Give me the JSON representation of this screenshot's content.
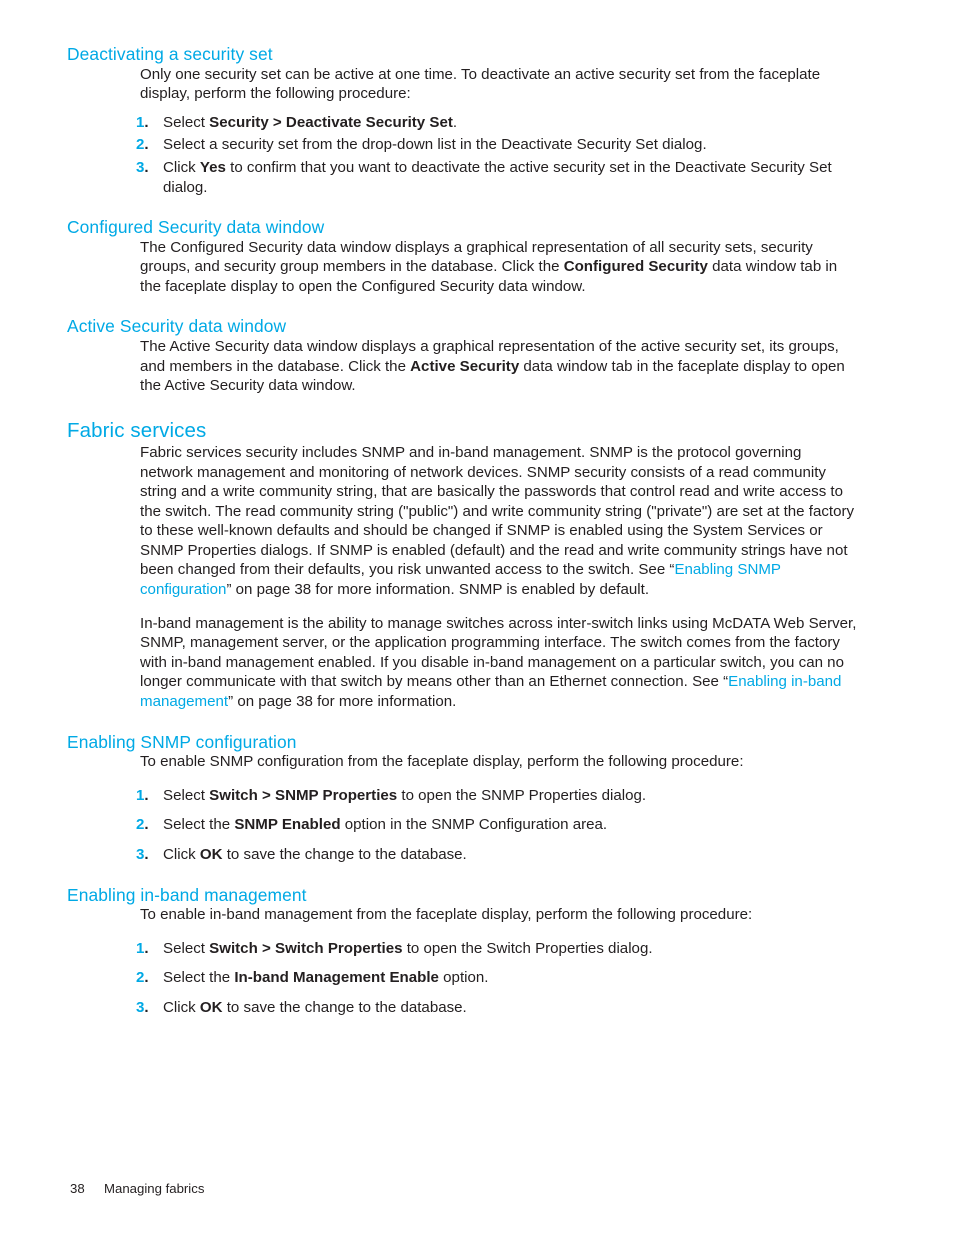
{
  "page": {
    "footer_page_number": "38",
    "footer_chapter": "Managing fabrics",
    "accent_color": "#00a9e5",
    "text_color": "#231f20"
  },
  "sections": {
    "deactivating": {
      "heading": "Deactivating a security set",
      "intro": "Only one security set can be active at one time. To deactivate an active security set from the faceplate display, perform the following procedure:",
      "steps": [
        {
          "number": "1.",
          "parts": [
            {
              "text": "Select ",
              "style": "normal"
            },
            {
              "text": "Security > Deactivate Security Set",
              "style": "bold"
            },
            {
              "text": ".",
              "style": "normal"
            }
          ]
        },
        {
          "number": "2.",
          "parts": [
            {
              "text": "Select a security set from the drop-down list in the Deactivate Security Set dialog.",
              "style": "normal"
            }
          ]
        },
        {
          "number": "3.",
          "parts": [
            {
              "text": "Click ",
              "style": "normal"
            },
            {
              "text": "Yes",
              "style": "bold"
            },
            {
              "text": " to confirm that you want to deactivate the active security set in the Deactivate Security Set dialog.",
              "style": "normal"
            }
          ]
        }
      ]
    },
    "configured_security": {
      "heading": "Configured Security data window",
      "body_parts": [
        {
          "text": "The Configured Security data window displays a graphical representation of all security sets, security groups, and security group members in the database. Click the ",
          "style": "normal"
        },
        {
          "text": "Configured Security",
          "style": "bold"
        },
        {
          "text": " data window tab in the faceplate display to open the Configured Security data window.",
          "style": "normal"
        }
      ]
    },
    "active_security": {
      "heading": "Active Security data window",
      "body_parts": [
        {
          "text": "The Active Security data window displays a graphical representation of the active security set, its groups, and members in the database. Click the ",
          "style": "normal"
        },
        {
          "text": "Active Security",
          "style": "bold"
        },
        {
          "text": " data window tab in the faceplate display to open the Active Security data window.",
          "style": "normal"
        }
      ]
    },
    "fabric_services": {
      "heading": "Fabric services",
      "paragraph1_parts": [
        {
          "text": "Fabric services security includes SNMP and in-band management. SNMP is the protocol governing network management and monitoring of network devices. SNMP security consists of a read community string and a write community string, that are basically the passwords that control read and write access to the switch. The read community string (\"public\") and write community string (\"private\") are set at the factory to these well-known defaults and should be changed if SNMP is enabled using the System Services or SNMP Properties dialogs. If SNMP is enabled (default) and the read and write community strings have not been changed from their defaults, you risk unwanted access to the switch. See “",
          "style": "normal"
        },
        {
          "text": "Enabling SNMP configuration",
          "style": "xref"
        },
        {
          "text": "” on page 38 for more information. SNMP is enabled by default.",
          "style": "normal"
        }
      ],
      "paragraph2_parts": [
        {
          "text": "In-band management is the ability to manage switches across inter-switch links using McDATA Web Server, SNMP, management server, or the application programming interface. The switch comes from the factory with in-band management enabled. If you disable in-band management on a particular switch, you can no longer communicate with that switch by means other than an Ethernet connection. See “",
          "style": "normal"
        },
        {
          "text": "Enabling in-band management",
          "style": "xref"
        },
        {
          "text": "” on page 38 for more information.",
          "style": "normal"
        }
      ]
    },
    "enabling_snmp": {
      "heading": "Enabling SNMP configuration",
      "intro": "To enable SNMP configuration from the faceplate display, perform the following procedure:",
      "steps": [
        {
          "number": "1.",
          "parts": [
            {
              "text": "Select ",
              "style": "normal"
            },
            {
              "text": "Switch > SNMP Properties",
              "style": "bold"
            },
            {
              "text": " to open the SNMP Properties dialog.",
              "style": "normal"
            }
          ]
        },
        {
          "number": "2.",
          "parts": [
            {
              "text": "Select the ",
              "style": "normal"
            },
            {
              "text": "SNMP Enabled",
              "style": "bold"
            },
            {
              "text": " option in the SNMP Configuration area.",
              "style": "normal"
            }
          ]
        },
        {
          "number": "3.",
          "parts": [
            {
              "text": "Click ",
              "style": "normal"
            },
            {
              "text": "OK",
              "style": "bold"
            },
            {
              "text": " to save the change to the database.",
              "style": "normal"
            }
          ]
        }
      ]
    },
    "enabling_inband": {
      "heading": "Enabling in-band management",
      "intro": "To enable in-band management from the faceplate display, perform the following procedure:",
      "steps": [
        {
          "number": "1.",
          "parts": [
            {
              "text": "Select ",
              "style": "normal"
            },
            {
              "text": "Switch > Switch Properties",
              "style": "bold"
            },
            {
              "text": " to open the Switch Properties dialog.",
              "style": "normal"
            }
          ]
        },
        {
          "number": "2.",
          "parts": [
            {
              "text": "Select the ",
              "style": "normal"
            },
            {
              "text": "In-band Management Enable",
              "style": "bold"
            },
            {
              "text": " option.",
              "style": "normal"
            }
          ]
        },
        {
          "number": "3.",
          "parts": [
            {
              "text": "Click ",
              "style": "normal"
            },
            {
              "text": "OK",
              "style": "bold"
            },
            {
              "text": " to save the change to the database.",
              "style": "normal"
            }
          ]
        }
      ]
    }
  }
}
